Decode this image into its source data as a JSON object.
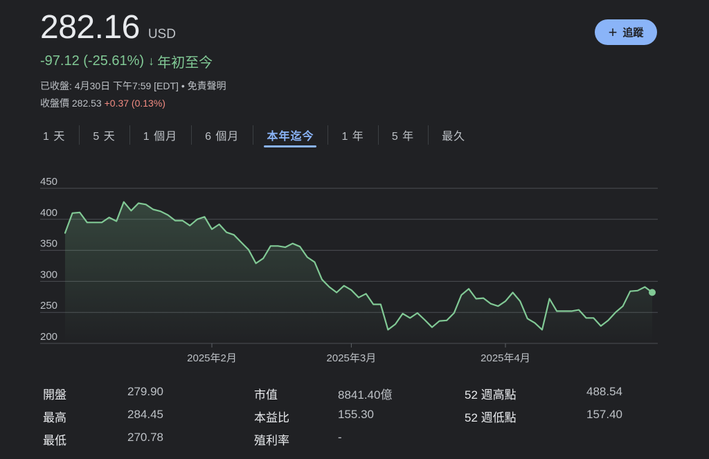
{
  "header": {
    "price": "282.16",
    "currency": "USD",
    "change": "-97.12 (-25.61%)",
    "change_arrow": "↓",
    "period": "年初至今",
    "closed_info": "已收盤: 4月30日 下午7:59 [EDT] • 免責聲明",
    "close_label": "收盤價",
    "close_price": "282.53",
    "close_change": "+0.37 (0.13%)",
    "follow_label": "追蹤",
    "follow_icon": "plus-icon"
  },
  "tabs": [
    {
      "label": "1 天",
      "active": false
    },
    {
      "label": "5 天",
      "active": false
    },
    {
      "label": "1 個月",
      "active": false
    },
    {
      "label": "6 個月",
      "active": false
    },
    {
      "label": "本年迄今",
      "active": true
    },
    {
      "label": "1 年",
      "active": false
    },
    {
      "label": "5 年",
      "active": false
    },
    {
      "label": "最久",
      "active": false
    }
  ],
  "colors": {
    "background": "#202124",
    "line": "#81c995",
    "grid": "#5f6368",
    "accent": "#8ab4f8",
    "negative": "#f28b82"
  },
  "chart_data": {
    "type": "area",
    "ylim": [
      200,
      450
    ],
    "yticks": [
      200,
      250,
      300,
      350,
      400,
      450
    ],
    "xtick_labels": [
      {
        "label": "2025年2月",
        "index": 20
      },
      {
        "label": "2025年3月",
        "index": 39
      },
      {
        "label": "2025年4月",
        "index": 60
      }
    ],
    "grid": true,
    "values": [
      378,
      410,
      411,
      395,
      395,
      395,
      403,
      397,
      428,
      414,
      426,
      424,
      416,
      413,
      407,
      398,
      398,
      390,
      400,
      404,
      384,
      392,
      379,
      375,
      363,
      351,
      329,
      337,
      357,
      357,
      355,
      361,
      356,
      339,
      331,
      303,
      291,
      282,
      293,
      286,
      274,
      280,
      263,
      263,
      222,
      231,
      248,
      241,
      249,
      238,
      226,
      236,
      237,
      249,
      278,
      288,
      272,
      273,
      264,
      260,
      268,
      282,
      268,
      240,
      233,
      222,
      272,
      252,
      252,
      252,
      254,
      241,
      241,
      228,
      237,
      250,
      260,
      284,
      285,
      291,
      282.16
    ]
  },
  "stats": [
    {
      "label": "開盤",
      "value": "279.90"
    },
    {
      "label": "最高",
      "value": "284.45"
    },
    {
      "label": "最低",
      "value": "270.78"
    },
    {
      "label": "市值",
      "value": "8841.40億"
    },
    {
      "label": "本益比",
      "value": "155.30"
    },
    {
      "label": "殖利率",
      "value": "-"
    },
    {
      "label": "52 週高點",
      "value": "488.54"
    },
    {
      "label": "52 週低點",
      "value": "157.40"
    }
  ]
}
